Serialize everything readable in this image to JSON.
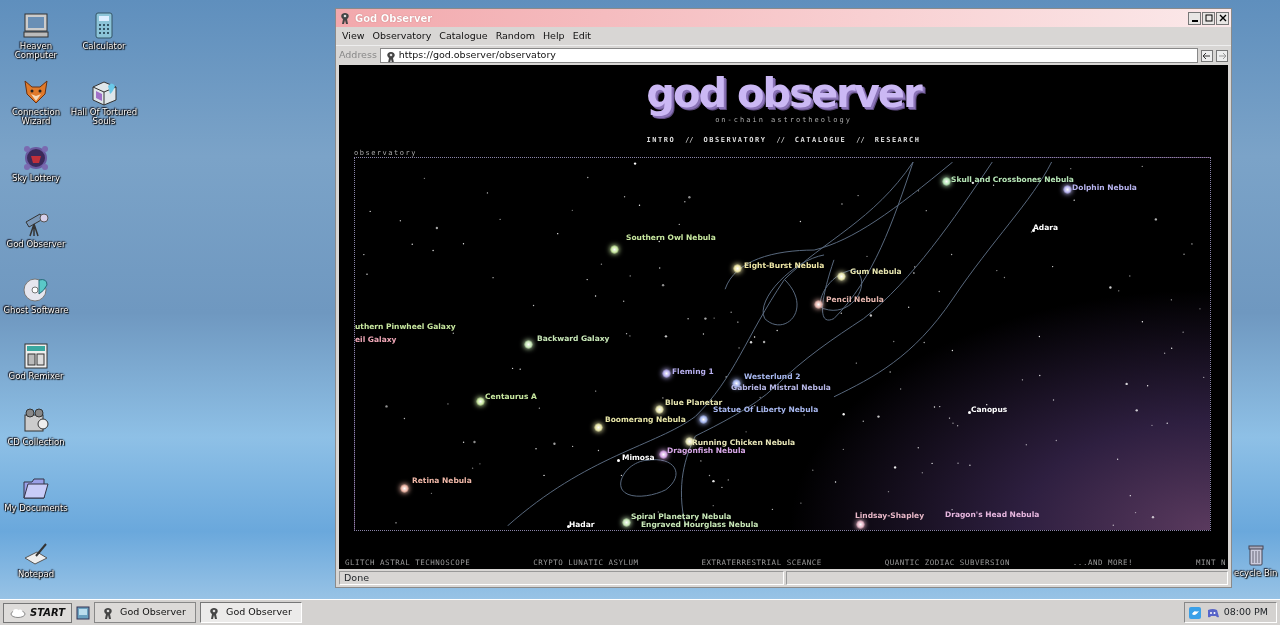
{
  "desktop_icons": [
    {
      "label": "Heaven Computer",
      "kind": "computer"
    },
    {
      "label": "Calculator",
      "kind": "calculator"
    },
    {
      "label": "Connection Wizard",
      "kind": "fox"
    },
    {
      "label": "Hall Of Tortured Souls",
      "kind": "cube"
    },
    {
      "label": "Sky Lottery",
      "kind": "lottery"
    },
    {
      "label": "God Observer",
      "kind": "telescope"
    },
    {
      "label": "Ghost Software",
      "kind": "disc"
    },
    {
      "label": "God Remixer",
      "kind": "remixer"
    },
    {
      "label": "CD Collection",
      "kind": "camera"
    },
    {
      "label": "My Documents",
      "kind": "folder"
    },
    {
      "label": "Notepad",
      "kind": "notepad"
    }
  ],
  "recycle_bin": {
    "label": "ecycle Bin"
  },
  "window": {
    "title": "God Observer",
    "menu": [
      "View",
      "Observatory",
      "Catalogue",
      "Random",
      "Help",
      "Edit"
    ],
    "address_label": "Address",
    "url": "https://god.observer/observatory",
    "page": {
      "logo": "god observer",
      "tagline": "on-chain astrotheology",
      "nav": [
        {
          "label": "INTRO",
          "kind": "link"
        },
        {
          "label": "//",
          "kind": "separator"
        },
        {
          "label": "OBSERVATORY",
          "kind": "link"
        },
        {
          "label": "//",
          "kind": "separator"
        },
        {
          "label": "CATALOGUE",
          "kind": "link"
        },
        {
          "label": "//",
          "kind": "separator"
        },
        {
          "label": "RESEARCH",
          "kind": "link"
        }
      ],
      "map": {
        "title": "observatory",
        "objects": [
          {
            "label": "Southern Owl Nebula",
            "color": "#c8e8a0"
          },
          {
            "label": "Eight-Burst Nebula",
            "color": "#f0e8a8"
          },
          {
            "label": "Skull and Crossbones Nebula",
            "color": "#b8e8b8"
          },
          {
            "label": "Dolphin Nebula",
            "color": "#b8b4f0"
          },
          {
            "label": "Adara",
            "color": "#ffffff"
          },
          {
            "label": "Gum Nebula",
            "color": "#e8e6b0"
          },
          {
            "label": "Pencil Nebula",
            "color": "#e8b8b0"
          },
          {
            "label": "uthern Pinwheel Galaxy",
            "color": "#c8e8a0"
          },
          {
            "label": "eil Galaxy",
            "color": "#f0a8b8"
          },
          {
            "label": "Backward Galaxy",
            "color": "#c8e8b8"
          },
          {
            "label": "Fleming 1",
            "color": "#b8b0f0"
          },
          {
            "label": "Westerlund 2",
            "color": "#a8b8f0"
          },
          {
            "label": "Gabriela Mistral Nebula",
            "color": "#b8b8e8"
          },
          {
            "label": "Centaurus A",
            "color": "#c8e8a0"
          },
          {
            "label": "Blue Planetar",
            "color": "#e8e6b0"
          },
          {
            "label": "Statue Of Liberty Nebula",
            "color": "#a8b8f0"
          },
          {
            "label": "Boomerang Nebula",
            "color": "#e8e6a8"
          },
          {
            "label": "Running Chicken Nebula",
            "color": "#e8e6b8"
          },
          {
            "label": "Dragonfish Nebula",
            "color": "#d8a8e8"
          },
          {
            "label": "Mimosa",
            "color": "#ffffff"
          },
          {
            "label": "Canopus",
            "color": "#ffffff"
          },
          {
            "label": "Retina Nebula",
            "color": "#f0b8a8"
          },
          {
            "label": "Spiral Planetary Nebula",
            "color": "#c8e8b8"
          },
          {
            "label": "Hadar",
            "color": "#ffffff"
          },
          {
            "label": "Engraved Hourglass Nebula",
            "color": "#c8e8b8"
          },
          {
            "label": "Lindsay-Shapley",
            "color": "#e8b8c8"
          },
          {
            "label": "Dragon's Head Nebula",
            "color": "#e8b8e0"
          }
        ]
      },
      "footer": [
        "GLITCH ASTRAL TECHNOSCOPE",
        "CRYPTO LUNATIC ASYLUM",
        "EXTRATERRESTRIAL SCEANCE",
        "QUANTIC ZODIAC SUBVERSION",
        "...AND MORE!",
        "MINT N"
      ]
    },
    "status": "Done"
  },
  "taskbar": {
    "start": "START",
    "tasks": [
      {
        "label": "God Observer",
        "selected": false
      },
      {
        "label": "God Observer",
        "selected": true
      }
    ],
    "clock": "08:00 PM"
  }
}
